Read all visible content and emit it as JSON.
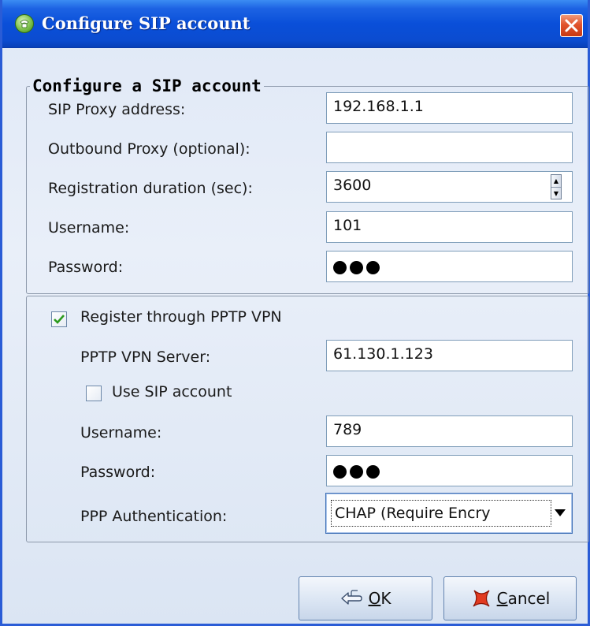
{
  "window": {
    "title": "Configure SIP account"
  },
  "sip_group": {
    "legend": "Configure a SIP account",
    "proxy_label": "SIP Proxy address:",
    "proxy_value": "192.168.1.1",
    "outbound_label": "Outbound Proxy (optional):",
    "outbound_value": "",
    "registration_label": "Registration duration (sec):",
    "registration_value": "3600",
    "username_label": "Username:",
    "username_value": "101",
    "password_label": "Password:"
  },
  "vpn_group": {
    "register_vpn_label": "Register through PPTP VPN",
    "register_vpn_checked": true,
    "server_label": "PPTP VPN Server:",
    "server_value": "61.130.1.123",
    "use_sip_label": "Use SIP account",
    "use_sip_checked": false,
    "username_label": "Username:",
    "username_value": "789",
    "password_label": "Password:",
    "auth_label": "PPP Authentication:",
    "auth_value": "CHAP (Require Encry"
  },
  "buttons": {
    "ok_label": "OK",
    "cancel_label": "Cancel"
  },
  "icons": {
    "app": "phone-icon",
    "close": "close-icon",
    "ok": "hand-point-icon",
    "cancel": "red-x-icon"
  },
  "colors": {
    "titlebar": "#0a4fd9",
    "close_button": "#e1542d",
    "checkmark": "#2b9a1e"
  }
}
